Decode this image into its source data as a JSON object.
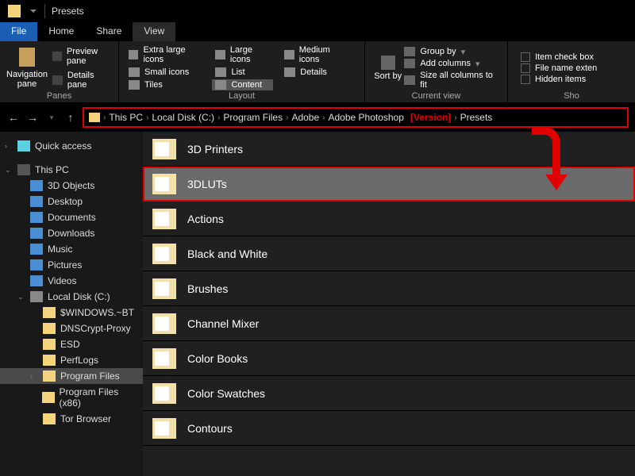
{
  "window": {
    "title": "Presets"
  },
  "menubar": {
    "file": "File",
    "home": "Home",
    "share": "Share",
    "view": "View"
  },
  "ribbon": {
    "panes": {
      "nav": "Navigation\npane",
      "preview": "Preview pane",
      "details": "Details pane",
      "label": "Panes"
    },
    "layout": {
      "xlarge": "Extra large icons",
      "large": "Large icons",
      "medium": "Medium icons",
      "small": "Small icons",
      "list": "List",
      "details": "Details",
      "tiles": "Tiles",
      "content": "Content",
      "label": "Layout"
    },
    "sort": "Sort by",
    "cview": {
      "group": "Group by",
      "add": "Add columns",
      "size": "Size all columns to fit",
      "label": "Current view"
    },
    "show": {
      "itemcheck": "Item check box",
      "fileext": "File name exten",
      "hidden": "Hidden items",
      "label": "Sho"
    }
  },
  "breadcrumb": [
    "This PC",
    "Local Disk (C:)",
    "Program Files",
    "Adobe",
    "Adobe Photoshop",
    "Presets"
  ],
  "breadcrumb_version": "[Version]",
  "sidebar": {
    "quick": "Quick access",
    "pc": "This PC",
    "pcitems": [
      "3D Objects",
      "Desktop",
      "Documents",
      "Downloads",
      "Music",
      "Pictures",
      "Videos"
    ],
    "disk": "Local Disk (C:)",
    "diskitems": [
      "$WINDOWS.~BT",
      "DNSCrypt-Proxy",
      "ESD",
      "PerfLogs",
      "Program Files",
      "Program Files (x86)",
      "Tor Browser"
    ]
  },
  "folders": [
    "3D Printers",
    "3DLUTs",
    "Actions",
    "Black and White",
    "Brushes",
    "Channel Mixer",
    "Color Books",
    "Color Swatches",
    "Contours"
  ],
  "highlighted": "3DLUTs"
}
